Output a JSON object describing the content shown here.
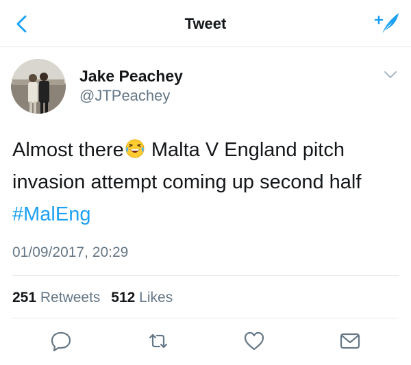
{
  "header": {
    "title": "Tweet",
    "back_icon": "chevron-left-icon",
    "compose_icon": "compose-tweet-icon",
    "accent": "#1da1f2"
  },
  "tweet": {
    "author": {
      "name": "Jake Peachey",
      "handle": "@JTPeachey",
      "avatar": "profile-photo"
    },
    "text_part1": "Almost there",
    "emoji": "😂",
    "text_part2": " Malta V England pitch invasion attempt coming up second half ",
    "hashtag": "#MalEng",
    "timestamp": "01/09/2017, 20:29",
    "stats": {
      "retweets_count": "251",
      "retweets_label": "Retweets",
      "likes_count": "512",
      "likes_label": "Likes"
    },
    "actions": [
      "reply-icon",
      "retweet-icon",
      "like-icon",
      "share-icon"
    ]
  },
  "colors": {
    "text": "#14171a",
    "secondary": "#657786",
    "divider": "#e1e8ed",
    "hashtag": "#1da1f2"
  }
}
